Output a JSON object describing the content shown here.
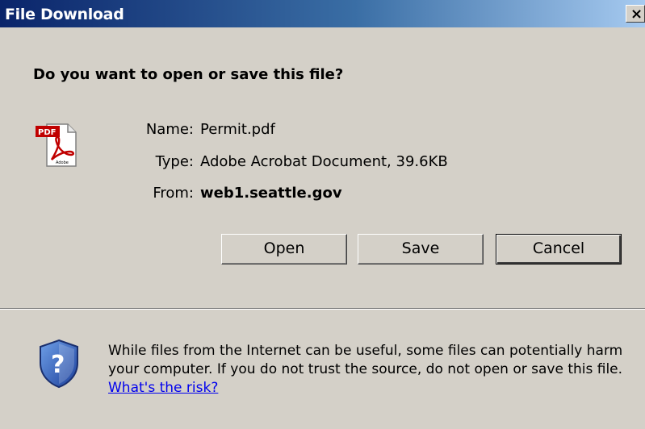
{
  "window": {
    "title": "File Download",
    "close_glyph": "×"
  },
  "dialog": {
    "question": "Do you want to open or save this file?",
    "file_icon": "pdf-file-icon",
    "fields": {
      "name_label": "Name:",
      "name_value": "Permit.pdf",
      "type_label": "Type:",
      "type_value": "Adobe Acrobat Document, 39.6KB",
      "from_label": "From:",
      "from_value": "web1.seattle.gov"
    },
    "buttons": {
      "open": "Open",
      "save": "Save",
      "cancel": "Cancel"
    },
    "warning": {
      "text": "While files from the Internet can be useful, some files can potentially harm your computer. If you do not trust the source, do not open or save this file. ",
      "link": "What's the risk?",
      "icon": "shield-question-icon"
    }
  },
  "colors": {
    "title_bar": "#0a246a",
    "dialog_bg": "#d4d0c8",
    "link": "#0000ee"
  }
}
